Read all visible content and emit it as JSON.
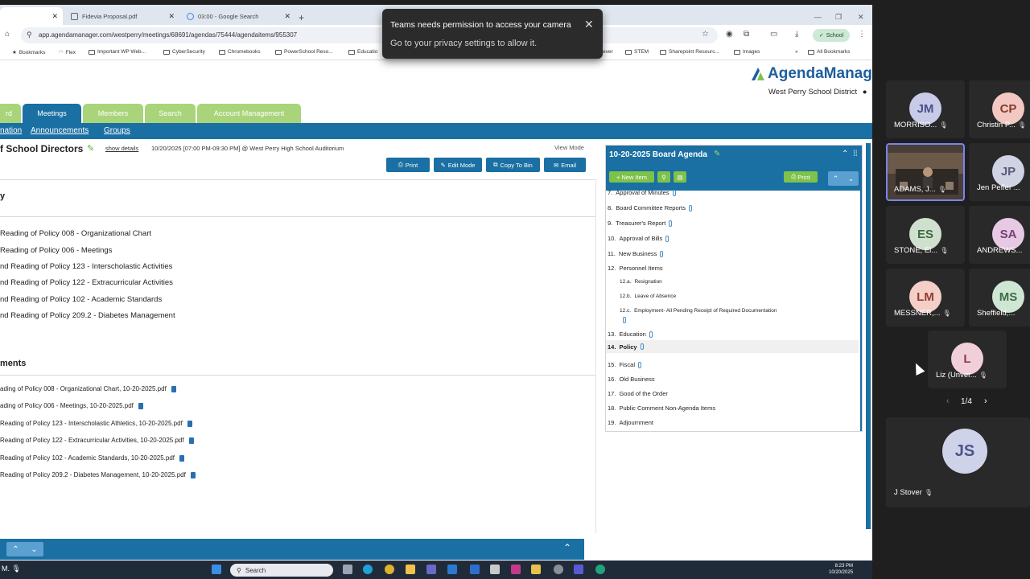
{
  "browser": {
    "tabs": [
      {
        "label": "",
        "active": true
      },
      {
        "label": "Fidevia Proposal.pdf"
      },
      {
        "label": "03:00 - Google Search"
      }
    ],
    "url": "app.agendamanager.com/westperry/meetings/68691/agendas/75444/agendaitems/955307",
    "profile_label": "School",
    "bookmarks": [
      "Bookmarks",
      "Flex",
      "Important WP Web...",
      "CyberSecurity",
      "Chromebooks",
      "PowerSchool Reso...",
      "Educatio",
      "ever",
      "STEM",
      "Sharepoint Resourc...",
      "Images",
      "All Bookmarks"
    ]
  },
  "toast": {
    "title": "Teams needs permission to access your camera",
    "body": "Go to your privacy settings to allow it."
  },
  "app": {
    "logo_text": "AgendaManager",
    "district": "West Perry School District",
    "nav_tabs": [
      "rd",
      "Meetings",
      "Members",
      "Search",
      "Account Management"
    ],
    "sub_links": [
      "nation",
      "Announcements",
      "Groups"
    ],
    "meeting_title": "f School Directors",
    "show_details": "show details",
    "meeting_info": "10/20/2025 [07:00 PM-09:30 PM] @ West Perry High School Auditorium",
    "view_mode": "View Mode",
    "actions": [
      "Print",
      "Edit Mode",
      "Copy To Bin",
      "Email"
    ],
    "section_title": "y",
    "policy_lines": [
      "Reading of Policy 008 - Organizational Chart",
      "Reading of Policy 006 - Meetings",
      "nd Reading of Policy 123 - Interscholastic Activities",
      "nd Reading of Policy 122 - Extracurricular Activities",
      "nd Reading of Policy 102 - Academic Standards",
      "nd Reading of Policy 209.2 - Diabetes Management"
    ],
    "attachments_title": "ments",
    "attachments": [
      "ading of Policy 008 - Organizational Chart, 10-20-2025.pdf",
      "ading of Policy 006 - Meetings, 10-20-2025.pdf",
      "Reading of Policy 123 - Interscholastic Athletics, 10-20-2025.pdf",
      "Reading of Policy 122 - Extracurricular Activities, 10-20-2025.pdf",
      "Reading of Policy 102 - Academic Standards, 10-20-2025.pdf",
      "Reading of Policy 209.2 - Diabetes Management, 10-20-2025.pdf"
    ]
  },
  "agenda": {
    "title": "10-20-2025 Board Agenda",
    "new_item": "New Item",
    "print": "Print",
    "items": [
      {
        "num": "7.",
        "label": "Approval of Minutes",
        "clip": true
      },
      {
        "num": "8.",
        "label": "Board Committee Reports",
        "clip": true
      },
      {
        "num": "9.",
        "label": "Treasurer's Report",
        "clip": true
      },
      {
        "num": "10.",
        "label": "Approval of Bills",
        "clip": true
      },
      {
        "num": "11.",
        "label": "New Business",
        "clip": true
      },
      {
        "num": "12.",
        "label": "Personnel Items",
        "clip": false
      },
      {
        "num": "12.a.",
        "label": "Resignation",
        "sub": true
      },
      {
        "num": "12.b.",
        "label": "Leave of Absence",
        "sub": true
      },
      {
        "num": "12.c.",
        "label": "Employment- All Pending Receipt of Required Documentation",
        "sub": true
      },
      {
        "num": "13.",
        "label": "Education",
        "clip": true
      },
      {
        "num": "14.",
        "label": "Policy",
        "clip": true,
        "selected": true
      },
      {
        "num": "15.",
        "label": "Fiscal",
        "clip": true
      },
      {
        "num": "16.",
        "label": "Old Business",
        "clip": false
      },
      {
        "num": "17.",
        "label": "Good of the Order",
        "clip": false
      },
      {
        "num": "18.",
        "label": "Public Comment Non-Agenda Items",
        "clip": false
      },
      {
        "num": "19.",
        "label": "Adjournment",
        "clip": false
      }
    ]
  },
  "taskbar": {
    "left_text": "M.",
    "search_placeholder": "Search",
    "time": "8:23 PM",
    "date": "10/20/2025"
  },
  "teams": {
    "participants": [
      {
        "initials": "JM",
        "name": "MORRISO...",
        "bg": "#c7cbe8",
        "fg": "#4a4f8a"
      },
      {
        "initials": "CP",
        "name": "Christin P...",
        "bg": "#f2c9c2",
        "fg": "#8a3b2e"
      },
      {
        "initials": "",
        "name": "ADAMS, J...",
        "video": true
      },
      {
        "initials": "JP",
        "name": "Jen Peffer ...",
        "bg": "#d0d3e4",
        "fg": "#575c78"
      },
      {
        "initials": "ES",
        "name": "STONE, El...",
        "bg": "#cfe0cf",
        "fg": "#3f6a3f"
      },
      {
        "initials": "SA",
        "name": "ANDREWS...",
        "bg": "#e6c9e3",
        "fg": "#7a3f74"
      },
      {
        "initials": "LM",
        "name": "MESSNER,...",
        "bg": "#f4cfc7",
        "fg": "#8f3d2f"
      },
      {
        "initials": "MS",
        "name": "Sheffield,...",
        "bg": "#cfe6d4",
        "fg": "#3c6e48"
      },
      {
        "initials": "L",
        "name": "Liz (Unver...",
        "bg": "#f1cfd9",
        "fg": "#8a3a52"
      }
    ],
    "page_indicator": "1/4",
    "self": {
      "initials": "JS",
      "name": "J Stover",
      "bg": "#cfd3ea",
      "fg": "#4e5488"
    }
  }
}
